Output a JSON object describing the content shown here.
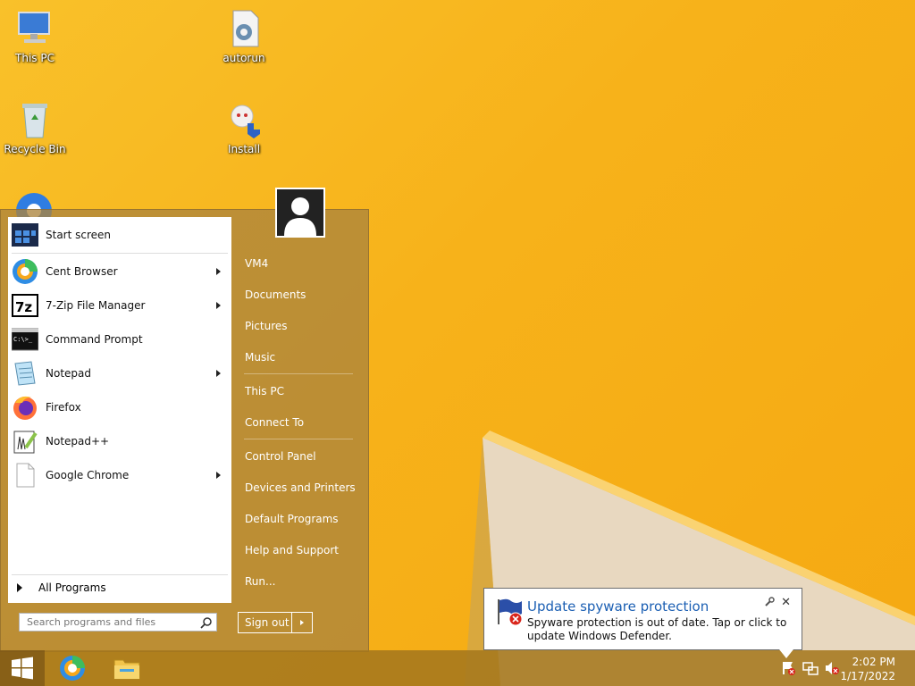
{
  "desktop": {
    "icons": [
      {
        "label": "This PC",
        "name": "this-pc"
      },
      {
        "label": "autorun",
        "name": "autorun"
      },
      {
        "label": "Recycle Bin",
        "name": "recycle-bin"
      },
      {
        "label": "Install",
        "name": "install"
      }
    ]
  },
  "start_menu": {
    "programs": [
      {
        "label": "Start screen",
        "icon": "start-screen-icon",
        "submenu": false
      },
      {
        "label": "Cent Browser",
        "icon": "cent-browser-icon",
        "submenu": true
      },
      {
        "label": "7-Zip File Manager",
        "icon": "7zip-icon",
        "submenu": true
      },
      {
        "label": "Command Prompt",
        "icon": "command-prompt-icon",
        "submenu": false
      },
      {
        "label": "Notepad",
        "icon": "notepad-icon",
        "submenu": true
      },
      {
        "label": "Firefox",
        "icon": "firefox-icon",
        "submenu": false
      },
      {
        "label": "Notepad++",
        "icon": "notepadpp-icon",
        "submenu": false
      },
      {
        "label": "Google Chrome",
        "icon": "google-chrome-icon",
        "submenu": true
      }
    ],
    "all_programs": "All Programs",
    "search_placeholder": "Search programs and files",
    "right_items": [
      "VM4",
      "Documents",
      "Pictures",
      "Music",
      "This PC",
      "Connect To",
      "Control Panel",
      "Devices and Printers",
      "Default Programs",
      "Help and Support",
      "Run..."
    ],
    "sign_out": "Sign out"
  },
  "taskbar": {
    "time": "2:02 PM",
    "date": "1/17/2022"
  },
  "notification": {
    "title": "Update spyware protection",
    "message": "Spyware protection is out of date. Tap or click to update Windows Defender.",
    "close": "✕"
  },
  "colors": {
    "wallpaper": "#f7b21a",
    "notification_title": "#1b5fb3"
  }
}
